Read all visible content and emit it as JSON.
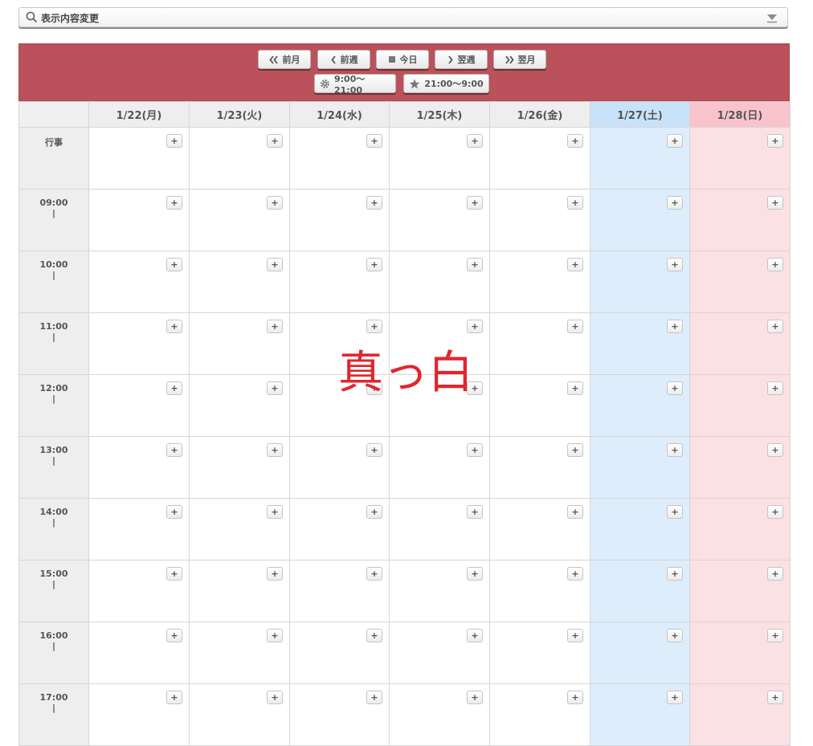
{
  "filter": {
    "label": "表示内容変更"
  },
  "nav": {
    "prev_month": "前月",
    "prev_week": "前週",
    "today": "今日",
    "next_week": "翌週",
    "next_month": "翌月",
    "range_day": "9:00～21:00",
    "range_night": "21:00～9:00"
  },
  "calendar": {
    "days": [
      {
        "label": "1/22(月)",
        "kind": "weekday"
      },
      {
        "label": "1/23(火)",
        "kind": "weekday"
      },
      {
        "label": "1/24(水)",
        "kind": "weekday"
      },
      {
        "label": "1/25(木)",
        "kind": "weekday"
      },
      {
        "label": "1/26(金)",
        "kind": "weekday"
      },
      {
        "label": "1/27(土)",
        "kind": "sat"
      },
      {
        "label": "1/28(日)",
        "kind": "sun"
      }
    ],
    "rows": [
      {
        "label": "行事",
        "tick": ""
      },
      {
        "label": "09:00",
        "tick": "|"
      },
      {
        "label": "10:00",
        "tick": "|"
      },
      {
        "label": "11:00",
        "tick": "|"
      },
      {
        "label": "12:00",
        "tick": "|"
      },
      {
        "label": "13:00",
        "tick": "|"
      },
      {
        "label": "14:00",
        "tick": "|"
      },
      {
        "label": "15:00",
        "tick": "|"
      },
      {
        "label": "16:00",
        "tick": "|"
      },
      {
        "label": "17:00",
        "tick": "|"
      }
    ],
    "add_label": "+"
  },
  "overlay": {
    "text": "真っ白"
  },
  "colors": {
    "header_bar": "#bb525b",
    "saturday": "#deedfb",
    "sunday": "#fbe0e4",
    "overlay_text": "#e0262f"
  }
}
